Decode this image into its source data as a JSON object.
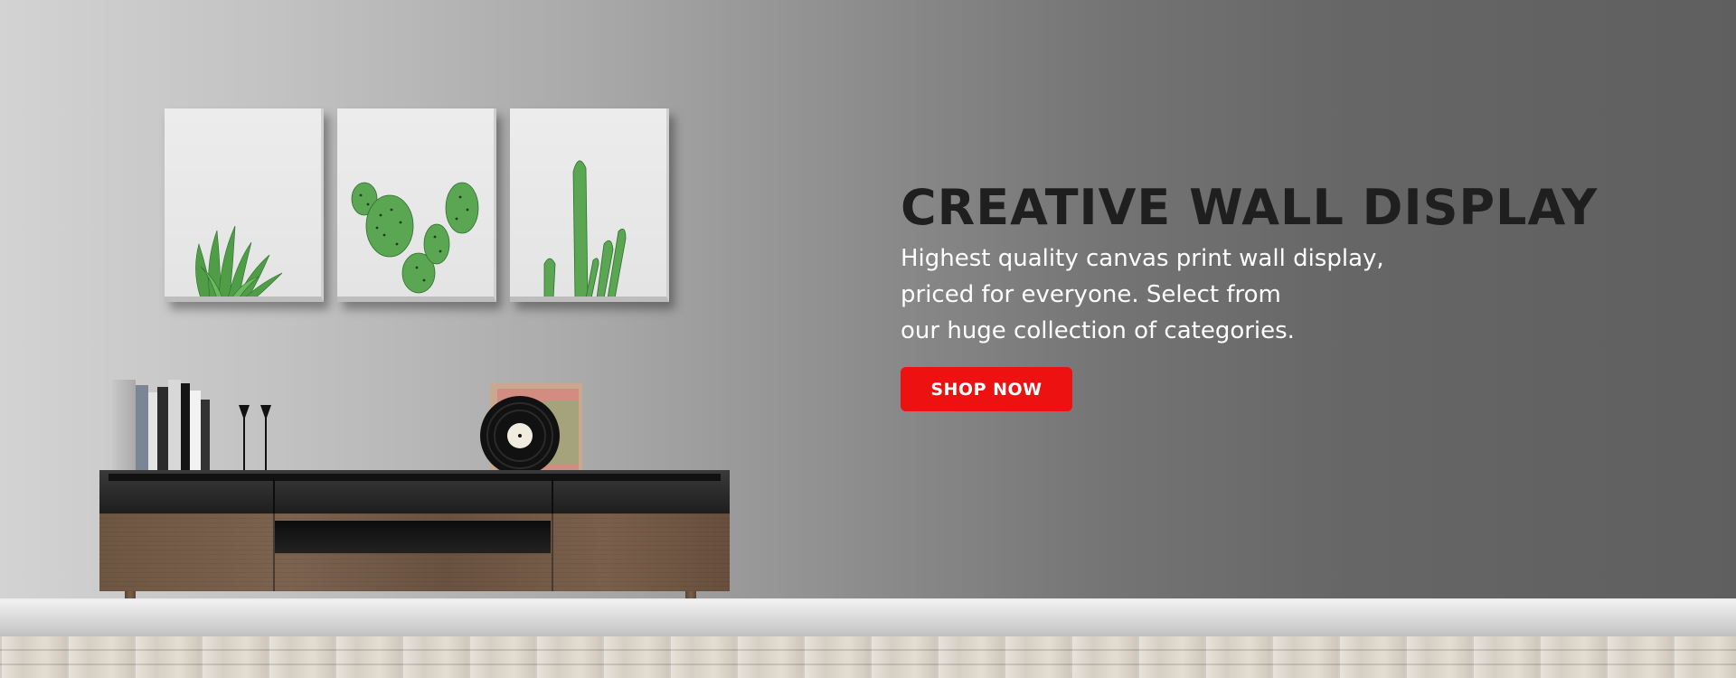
{
  "hero": {
    "headline": "CREATIVE WALL DISPLAY",
    "subheadline_lines": [
      "Highest quality canvas print wall display,",
      "priced for everyone. Select from",
      "our huge collection of categories."
    ],
    "cta_label": "SHOP NOW"
  },
  "scene": {
    "canvases": [
      "aloe-plant-print",
      "prickly-pear-cactus-print",
      "tall-cactus-print"
    ],
    "decor": [
      "sideboard",
      "books",
      "candle-holders",
      "vinyl-record"
    ]
  },
  "colors": {
    "cta_background": "#ee1111",
    "headline_text": "#1f1f1f",
    "subheadline_text": "#ffffff",
    "wall_left": "#d3d3d3",
    "wall_right": "#5f5f5f",
    "plant_green": "#4a9a4a"
  }
}
